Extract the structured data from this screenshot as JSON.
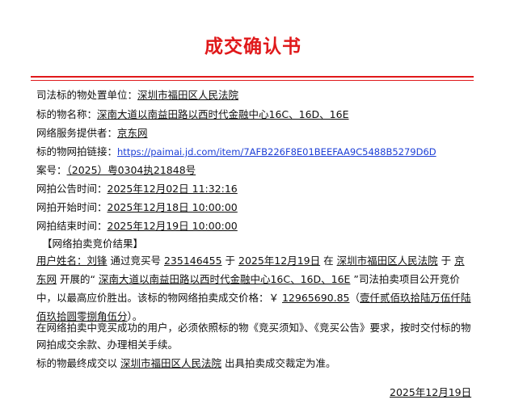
{
  "title": "成交确认书",
  "fields": [
    {
      "label": "司法标的物处置单位：",
      "value": "深圳市福田区人民法院"
    },
    {
      "label": "标的物名称：",
      "value": "深南大道以南益田路以西时代金融中心16C、16D、16E"
    },
    {
      "label": "网络服务提供者：",
      "value": "京东网"
    },
    {
      "label": "标的物网拍链接：",
      "value": "https://paimai.jd.com/item/7AFB226F8E01BEEFAA9C5488B5279D6D"
    },
    {
      "label": "案号：",
      "value": "（2025）粤0304执21848号"
    },
    {
      "label": "网拍公告时间：",
      "value": "2025年12月02日 11:32:16"
    },
    {
      "label": "网拍开始时间：",
      "value": "2025年12月18日 10:00:00"
    },
    {
      "label": "网拍结束时间：",
      "value": "2025年12月19日 10:00:00"
    }
  ],
  "result_heading": "【网络拍卖竞价结果】",
  "result": {
    "p1": "用户姓名：刘锋",
    "p2": " 通过竞买号 ",
    "p3": "235146455",
    "p4": " 于 ",
    "p5": "2025年12月19日",
    "p6": " 在 ",
    "p7": "深圳市福田区人民法院",
    "p8": "于",
    "p9": "京东网",
    "p10": " 开展的“ ",
    "p11": "深南大道以南益田路以西时代金融中心16C、16D、16E",
    "p12": " ”司法拍卖项目公开竞价中，以最高应价胜出。该标的物网络拍卖成交价格：￥ ",
    "p13": "12965690.85",
    "p14": "（",
    "p15": "壹仟贰佰玖拾陆万伍仟陆佰玖拾圆零捌角伍分",
    "p16": "）。"
  },
  "notice": "在网络拍卖中竞买成功的用户，必须依照标的物《竞买须知》、《竞买公告》要求，按时交付标的物网拍成交余款、办理相关手续。",
  "final": {
    "a": "标的物最终成交以",
    "b": "深圳市福田区人民法院",
    "c": "出具拍卖成交裁定为准。"
  },
  "date": "2025年12月19日"
}
